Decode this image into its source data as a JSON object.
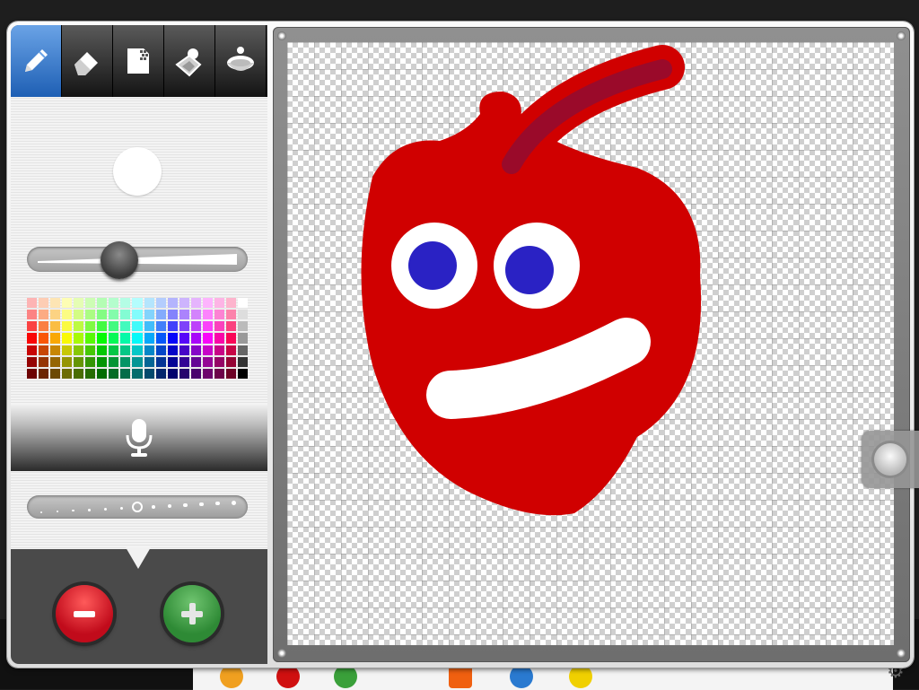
{
  "tools": [
    {
      "name": "pencil-tool",
      "icon": "pencil-icon",
      "active": true
    },
    {
      "name": "eraser-tool",
      "icon": "eraser-icon",
      "active": false
    },
    {
      "name": "canvas-tool",
      "icon": "document-grid-icon",
      "active": false
    },
    {
      "name": "fill-tool",
      "icon": "fill-bucket-icon",
      "active": false
    },
    {
      "name": "dish-tool",
      "icon": "bowl-icon",
      "active": false
    }
  ],
  "brush": {
    "preview_color": "#ffffff",
    "size_level": 0.4
  },
  "colors": {
    "accent": "#1e5fb4",
    "minus": "#c10b1b",
    "plus": "#2e8a35",
    "paint_red": "#d00000",
    "paint_blue": "#2a22c4",
    "stem": "#9a0a2a"
  },
  "tempo": {
    "dot_count": 13,
    "selected_index": 6
  },
  "icons": {
    "mic": "microphone-icon",
    "minus": "minus-icon",
    "plus": "plus-icon",
    "handle": "drag-handle-icon"
  }
}
